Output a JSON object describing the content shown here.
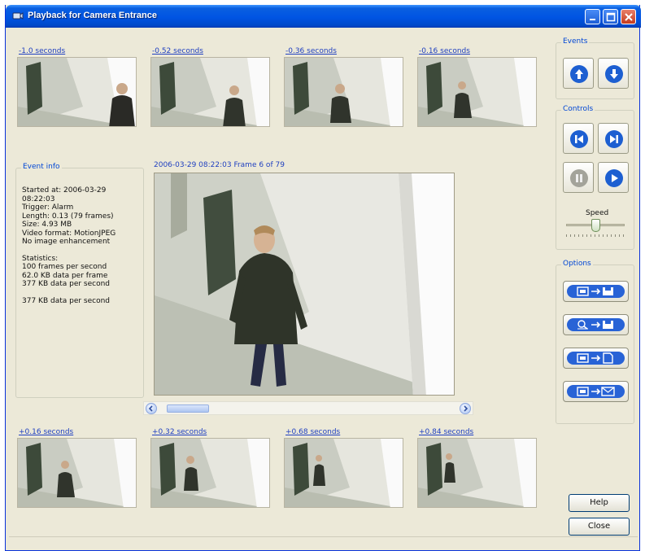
{
  "window": {
    "title": "Playback for Camera Entrance",
    "minimize_icon": "minimize-icon",
    "maximize_icon": "maximize-icon",
    "close_icon": "close-icon"
  },
  "thumbnails_top": [
    {
      "label": "-1.0 seconds"
    },
    {
      "label": "-0.52 seconds"
    },
    {
      "label": "-0.36 seconds"
    },
    {
      "label": "-0.16 seconds"
    }
  ],
  "thumbnails_bottom": [
    {
      "label": "+0.16 seconds"
    },
    {
      "label": "+0.32 seconds"
    },
    {
      "label": "+0.68 seconds"
    },
    {
      "label": "+0.84 seconds"
    }
  ],
  "event_info": {
    "title": "Event info",
    "lines": [
      "Started at: 2006-03-29",
      "08:22:03",
      "Trigger: Alarm",
      "Length: 0.13 (79 frames)",
      "Size: 4.93 MB",
      "Video format: MotionJPEG",
      "No image enhancement"
    ],
    "stats_lines": [
      "Statistics:",
      "100 frames per second",
      "62.0 KB data per frame",
      "377 KB data per second",
      "",
      "377 KB data per second"
    ]
  },
  "main_view": {
    "caption": "2006-03-29 08:22:03   Frame 6 of 79"
  },
  "events": {
    "title": "Events",
    "prev_icon": "arrow-up-icon",
    "next_icon": "arrow-down-icon"
  },
  "controls": {
    "title": "Controls",
    "first_icon": "skip-back-icon",
    "last_icon": "skip-forward-icon",
    "pause_icon": "pause-icon",
    "play_icon": "play-icon",
    "speed_label": "Speed",
    "speed_level": 0.5
  },
  "options": {
    "title": "Options",
    "buttons": [
      {
        "icon": "export-image-to-disk-icon"
      },
      {
        "icon": "export-search-to-disk-icon"
      },
      {
        "icon": "export-image-to-file-icon"
      },
      {
        "icon": "export-image-to-email-icon"
      }
    ]
  },
  "buttons": {
    "help": "Help",
    "close": "Close"
  },
  "colors": {
    "title_bar": "#0054e3",
    "link_blue": "#2040c0",
    "group_title": "#0046d5",
    "window_bg": "#ece9d8"
  }
}
